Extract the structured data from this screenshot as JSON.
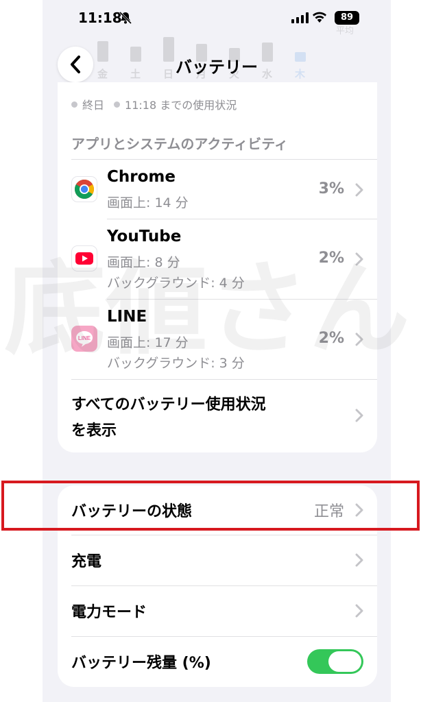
{
  "status_bar": {
    "time": "11:18",
    "battery": "89"
  },
  "background_chart": {
    "days": [
      "金",
      "土",
      "日",
      "月",
      "火",
      "水",
      "木"
    ],
    "badge": "平均"
  },
  "nav": {
    "title": "バッテリー"
  },
  "legend": {
    "item1": "終日",
    "item2": "11:18 までの使用状況"
  },
  "section_header": "アプリとシステムのアクティビティ",
  "apps": [
    {
      "name": "Chrome",
      "line1": "画面上: 14 分",
      "line2": "",
      "percent": "3%"
    },
    {
      "name": "YouTube",
      "line1": "画面上: 8 分",
      "line2": "バックグラウンド: 4 分",
      "percent": "2%"
    },
    {
      "name": "LINE",
      "line1": "画面上: 17 分",
      "line2": "バックグラウンド: 3 分",
      "percent": "2%"
    }
  ],
  "app_icon_labels": {
    "line": "LINE"
  },
  "all_usage": {
    "line1": "すべてのバッテリー使用状況",
    "line2": "を表示"
  },
  "settings": {
    "health": {
      "label": "バッテリーの状態",
      "value": "正常"
    },
    "charging": {
      "label": "充電"
    },
    "power_mode": {
      "label": "電力モード"
    },
    "percentage": {
      "label": "バッテリー残量 (%)",
      "enabled": true
    }
  },
  "watermark": "底値さん",
  "colors": {
    "toggle_on": "#34c759",
    "highlight": "#d7191f",
    "youtube": "#ff0033",
    "line_pink": "#f6a6c5"
  }
}
